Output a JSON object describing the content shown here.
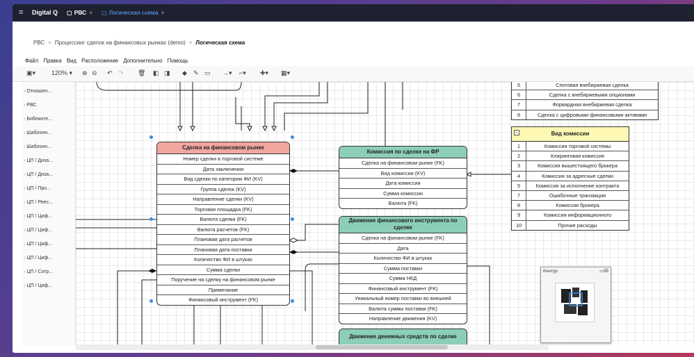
{
  "titlebar": {
    "app_name": "Digital Q",
    "tabs": [
      {
        "label": "РВС",
        "close": "×"
      },
      {
        "label": "Логическая схема",
        "close": "×"
      }
    ]
  },
  "breadcrumb": {
    "items": [
      "РВС",
      "Процессинг сделок на финансовых рынках (demo)"
    ],
    "current": "Логическая схема",
    "separator": ">"
  },
  "menubar": [
    "Файл",
    "Правка",
    "Вид",
    "Расположение",
    "Дополнительно",
    "Помощь"
  ],
  "toolbar": {
    "zoom": "120%"
  },
  "sidebar": {
    "items": [
      "Отношен...",
      "РВС",
      "Библиоте...",
      "Шаблонн...",
      "Шаблонн...",
      "ЦП / Дизa...",
      "ЦП / Дизa...",
      "ЦП / Про...",
      "ЦП / Реес...",
      "ЦП / Циф...",
      "ЦП / Циф...",
      "ЦП / Циф...",
      "ЦП / Циф...",
      "ЦП / Сотр...",
      "ЦП / Циф..."
    ]
  },
  "entities": {
    "deal": {
      "title": "Сделка на финансовом рынке",
      "rows": [
        "Номер сделки в торговой системе",
        "Дата заключения",
        "Вид сделки по категории ФИ (KV)",
        "Группа сделок (KV)",
        "Направление сделки (KV)",
        "Торговая площадка (FK)",
        "Валюта сделки (FK)",
        "Валюта расчетов (FK)",
        "Плановая дата расчетов",
        "Плановая дата поставки",
        "Количество ФИ в штуках",
        "Сумма сделки",
        "Поручение на сделку на финансовом рынке",
        "Примечание",
        "Финансовый инструмент (FK)"
      ]
    },
    "commission": {
      "title": "Комиссия по сделке на ФР",
      "rows": [
        "Сделка на финансовом рынке (FK)",
        "Вид комиссии (KV)",
        "Дата комиссии",
        "Сумма комиссии",
        "Валюта (FK)"
      ]
    },
    "instrument_move": {
      "title": "Движение финансового инструмента по сделке",
      "rows": [
        "Сделка на финансовом рынке (FK)",
        "Дата",
        "Количество ФИ в штуках",
        "Сумма поставки",
        "Сумма НКД",
        "Финансовый инструмент (FK)",
        "Уникальный номер поставки во внешней",
        "Валюта суммы поставки (FK)",
        "Направление движения (KV)"
      ]
    },
    "cash_move": {
      "title": "Движение денежных средств по сделке"
    }
  },
  "lookups": {
    "deal_types": {
      "rows": [
        {
          "n": "5",
          "t": "Спотовая внебиржевая сделка"
        },
        {
          "n": "6",
          "t": "Сделка с внебиржевыми опционами"
        },
        {
          "n": "7",
          "t": "Форвардная внебиржевая сделка"
        },
        {
          "n": "8",
          "t": "Сделка с цифровыми финансовыми активами"
        }
      ]
    },
    "commission_types": {
      "title": "Вид комиссии",
      "rows": [
        {
          "n": "1",
          "t": "Комиссия торговой системы"
        },
        {
          "n": "2",
          "t": "Клиринговая комиссия"
        },
        {
          "n": "3",
          "t": "Комиссия вышестоящего брокера"
        },
        {
          "n": "4",
          "t": "Комиссия за адресные сделки"
        },
        {
          "n": "5",
          "t": "Комиссия за исполнение контракта"
        },
        {
          "n": "7",
          "t": "Ошибочные транзакции"
        },
        {
          "n": "8",
          "t": "Комиссия брокера"
        },
        {
          "n": "9",
          "t": "Комиссия информационного"
        },
        {
          "n": "10",
          "t": "Прочие расходы"
        }
      ]
    }
  },
  "outline": {
    "title": "Контур"
  }
}
